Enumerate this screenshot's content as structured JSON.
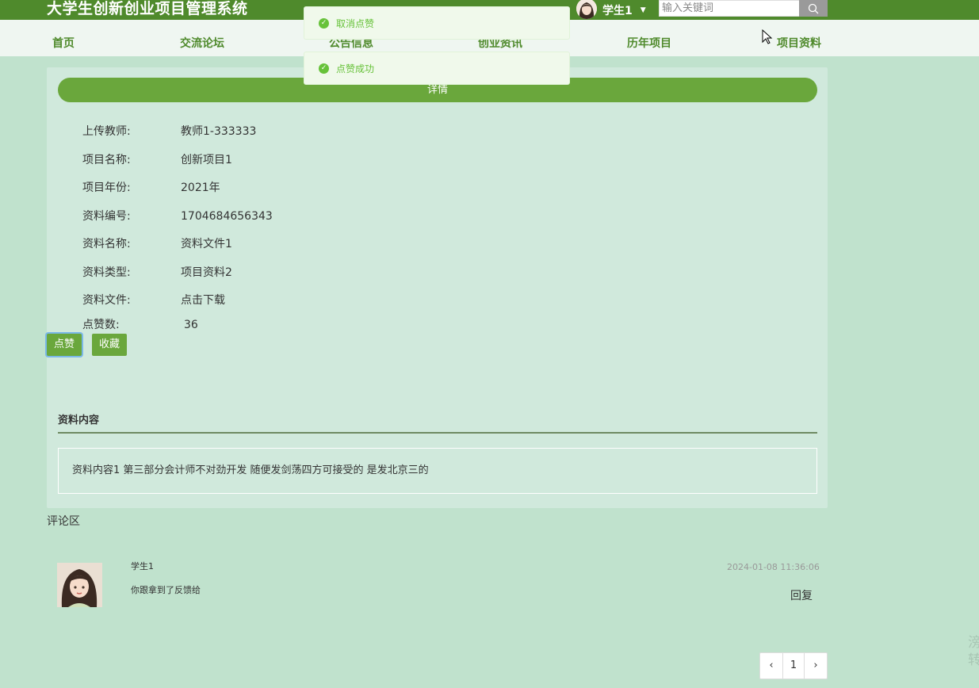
{
  "header": {
    "site_title": "大学生创新创业项目管理系统",
    "user_name": "学生1",
    "search_placeholder": "输入关键词"
  },
  "nav": {
    "items": [
      "首页",
      "交流论坛",
      "公告信息",
      "创业资讯",
      "历年项目",
      "项目资料"
    ]
  },
  "toasts": [
    "取消点赞",
    "点赞成功"
  ],
  "detail": {
    "bar_title": "详情",
    "fields": [
      {
        "label": "上传教师:",
        "value": "教师1-333333"
      },
      {
        "label": "项目名称:",
        "value": "创新项目1"
      },
      {
        "label": "项目年份:",
        "value": "2021年"
      },
      {
        "label": "资料编号:",
        "value": "1704684656343"
      },
      {
        "label": "资料名称:",
        "value": "资料文件1"
      },
      {
        "label": "资料类型:",
        "value": "项目资料2"
      },
      {
        "label": "资料文件:",
        "value": "点击下载"
      }
    ],
    "like_count_label": "点赞数:",
    "like_count": "36",
    "like_button": "点赞",
    "favorite_button": "收藏",
    "content_title": "资料内容",
    "content_text": "资料内容1 第三部分会计师不对劲开发 随便发剑荡四方可接受的 是发北京三的"
  },
  "comments": {
    "title": "评论区",
    "items": [
      {
        "user": "学生1",
        "text": "你跟拿到了反馈给",
        "time": "2024-01-08 11:36:06",
        "reply": "回复"
      }
    ]
  },
  "pagination": {
    "prev": "‹",
    "page": "1",
    "next": "›"
  },
  "side_text": [
    "滂",
    "转"
  ],
  "colors": {
    "accent": "#6aa73c",
    "header": "#4f8a2c",
    "background": "#c0e2cd"
  }
}
